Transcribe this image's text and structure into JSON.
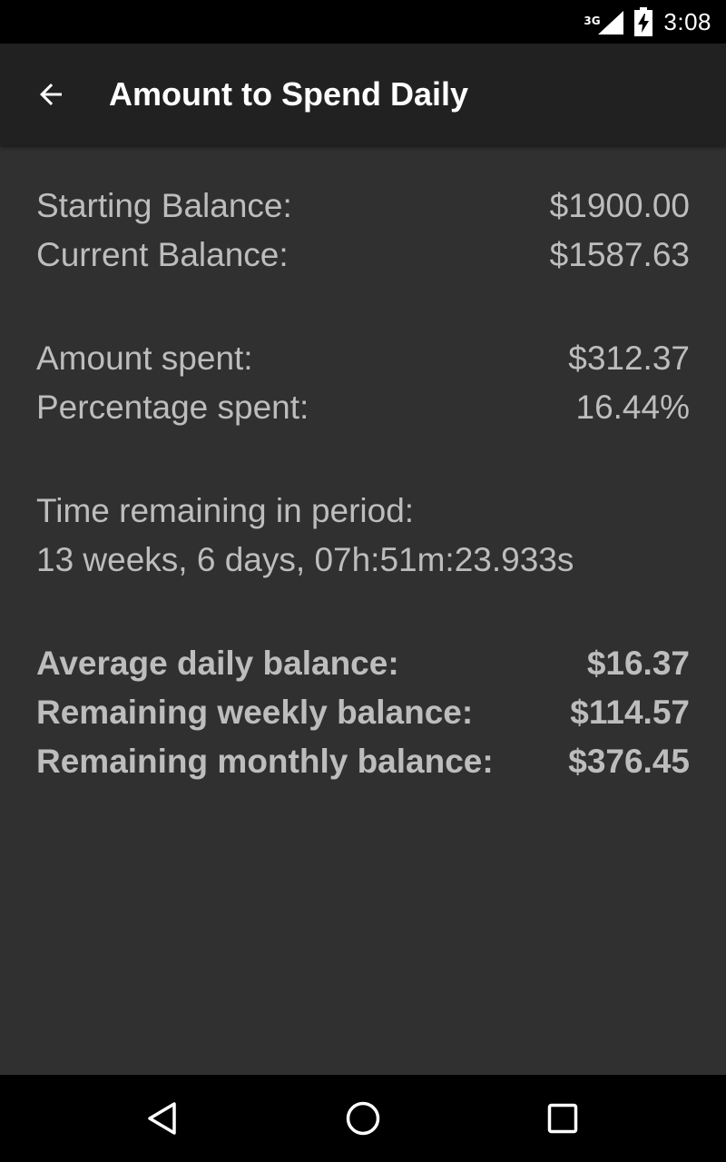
{
  "status_bar": {
    "network_type": "3G",
    "time": "3:08",
    "icons": [
      "signal-icon",
      "battery-charging-icon"
    ]
  },
  "app_bar": {
    "title": "Amount to Spend Daily",
    "back_icon": "arrow-back-icon"
  },
  "balances": {
    "starting_label": "Starting Balance:",
    "starting_value": "$1900.00",
    "current_label": "Current Balance:",
    "current_value": "$1587.63"
  },
  "spending": {
    "amount_label": "Amount spent:",
    "amount_value": "$312.37",
    "percentage_label": "Percentage spent:",
    "percentage_value": "16.44%"
  },
  "time_remaining": {
    "label": "Time remaining in period:",
    "value": "13 weeks, 6 days, 07h:51m:23.933s"
  },
  "summary": {
    "daily_label": "Average daily balance:",
    "daily_value": "$16.37",
    "weekly_label": "Remaining weekly balance:",
    "weekly_value": "$114.57",
    "monthly_label": "Remaining monthly balance:",
    "monthly_value": "$376.45"
  },
  "nav_bar": {
    "icons": [
      "back-triangle-icon",
      "home-circle-icon",
      "recents-square-icon"
    ]
  },
  "colors": {
    "background": "#303030",
    "app_bar": "#212121",
    "text": "#bdbdbd",
    "bars": "#000000"
  }
}
